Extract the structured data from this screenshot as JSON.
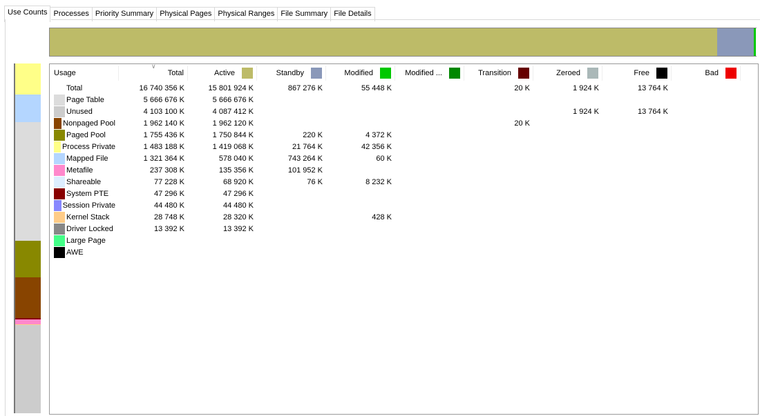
{
  "tabs": [
    "Use Counts",
    "Processes",
    "Priority Summary",
    "Physical Pages",
    "Physical Ranges",
    "File Summary",
    "File Details"
  ],
  "top_bar": [
    {
      "name": "Active",
      "fraction": 0.9439,
      "color": "#bdbb68"
    },
    {
      "name": "Standby",
      "fraction": 0.0518,
      "color": "#8a98b9"
    },
    {
      "name": "Modified",
      "fraction": 0.0033,
      "color": "#00c800"
    }
  ],
  "left_bar": [
    {
      "name": "Process Private",
      "fraction": 0.0886,
      "color": "#ffff88"
    },
    {
      "name": "Mapped File",
      "fraction": 0.0789,
      "color": "#b4d6ff"
    },
    {
      "name": "Unused",
      "fraction": 0.3385,
      "color": "#dcdcdc"
    },
    {
      "name": "Paged Pool",
      "fraction": 0.1049,
      "color": "#888800"
    },
    {
      "name": "Nonpaged Pool",
      "fraction": 0.1172,
      "color": "#884400"
    },
    {
      "name": "System PTE",
      "fraction": 0.0028,
      "color": "#880000"
    },
    {
      "name": "Metafile",
      "fraction": 0.0142,
      "color": "#ff88cc"
    },
    {
      "name": "Kernel Stack",
      "fraction": 0.002,
      "color": "#ffcc88"
    },
    {
      "name": "Page Table",
      "fraction": 0.2529,
      "color": "#cccccc"
    }
  ],
  "columns": [
    {
      "label": "Usage"
    },
    {
      "label": "Total"
    },
    {
      "label": "Active",
      "color": "#bdbb68"
    },
    {
      "label": "Standby",
      "color": "#8a98b9"
    },
    {
      "label": "Modified",
      "color": "#00c800"
    },
    {
      "label": "Modified ...",
      "color": "#008800"
    },
    {
      "label": "Transition",
      "color": "#660000"
    },
    {
      "label": "Zeroed",
      "color": "#aab8b8"
    },
    {
      "label": "Free",
      "color": "#000000"
    },
    {
      "label": "Bad",
      "color": "#ee0000"
    }
  ],
  "rows": [
    {
      "usage": "Total",
      "color": "",
      "values": [
        "16 740 356 K",
        "15 801 924 K",
        "867 276 K",
        "55 448 K",
        "",
        "20 K",
        "1 924 K",
        "13 764 K",
        ""
      ]
    },
    {
      "usage": "Page Table",
      "color": "#dcdcdc",
      "values": [
        "5 666 676 K",
        "5 666 676 K",
        "",
        "",
        "",
        "",
        "",
        "",
        ""
      ]
    },
    {
      "usage": "Unused",
      "color": "#cccccc",
      "values": [
        "4 103 100 K",
        "4 087 412 K",
        "",
        "",
        "",
        "",
        "1 924 K",
        "13 764 K",
        ""
      ]
    },
    {
      "usage": "Nonpaged Pool",
      "color": "#884400",
      "values": [
        "1 962 140 K",
        "1 962 120 K",
        "",
        "",
        "",
        "20 K",
        "",
        "",
        ""
      ]
    },
    {
      "usage": "Paged Pool",
      "color": "#888800",
      "values": [
        "1 755 436 K",
        "1 750 844 K",
        "220 K",
        "4 372 K",
        "",
        "",
        "",
        "",
        ""
      ]
    },
    {
      "usage": "Process Private",
      "color": "#ffff88",
      "values": [
        "1 483 188 K",
        "1 419 068 K",
        "21 764 K",
        "42 356 K",
        "",
        "",
        "",
        "",
        ""
      ]
    },
    {
      "usage": "Mapped File",
      "color": "#b4d6ff",
      "values": [
        "1 321 364 K",
        "578 040 K",
        "743 264 K",
        "60 K",
        "",
        "",
        "",
        "",
        ""
      ]
    },
    {
      "usage": "Metafile",
      "color": "#ff88cc",
      "values": [
        "237 308 K",
        "135 356 K",
        "101 952 K",
        "",
        "",
        "",
        "",
        "",
        ""
      ]
    },
    {
      "usage": "Shareable",
      "color": "#ddeeff",
      "values": [
        "77 228 K",
        "68 920 K",
        "76 K",
        "8 232 K",
        "",
        "",
        "",
        "",
        ""
      ]
    },
    {
      "usage": "System PTE",
      "color": "#880000",
      "values": [
        "47 296 K",
        "47 296 K",
        "",
        "",
        "",
        "",
        "",
        "",
        ""
      ]
    },
    {
      "usage": "Session Private",
      "color": "#8888ff",
      "values": [
        "44 480 K",
        "44 480 K",
        "",
        "",
        "",
        "",
        "",
        "",
        ""
      ]
    },
    {
      "usage": "Kernel Stack",
      "color": "#ffcc88",
      "values": [
        "28 748 K",
        "28 320 K",
        "",
        "428 K",
        "",
        "",
        "",
        "",
        ""
      ]
    },
    {
      "usage": "Driver Locked",
      "color": "#888888",
      "values": [
        "13 392 K",
        "13 392 K",
        "",
        "",
        "",
        "",
        "",
        "",
        ""
      ]
    },
    {
      "usage": "Large Page",
      "color": "#44ff88",
      "values": [
        "",
        "",
        "",
        "",
        "",
        "",
        "",
        "",
        ""
      ]
    },
    {
      "usage": "AWE",
      "color": "#000000",
      "values": [
        "",
        "",
        "",
        "",
        "",
        "",
        "",
        "",
        ""
      ]
    }
  ]
}
